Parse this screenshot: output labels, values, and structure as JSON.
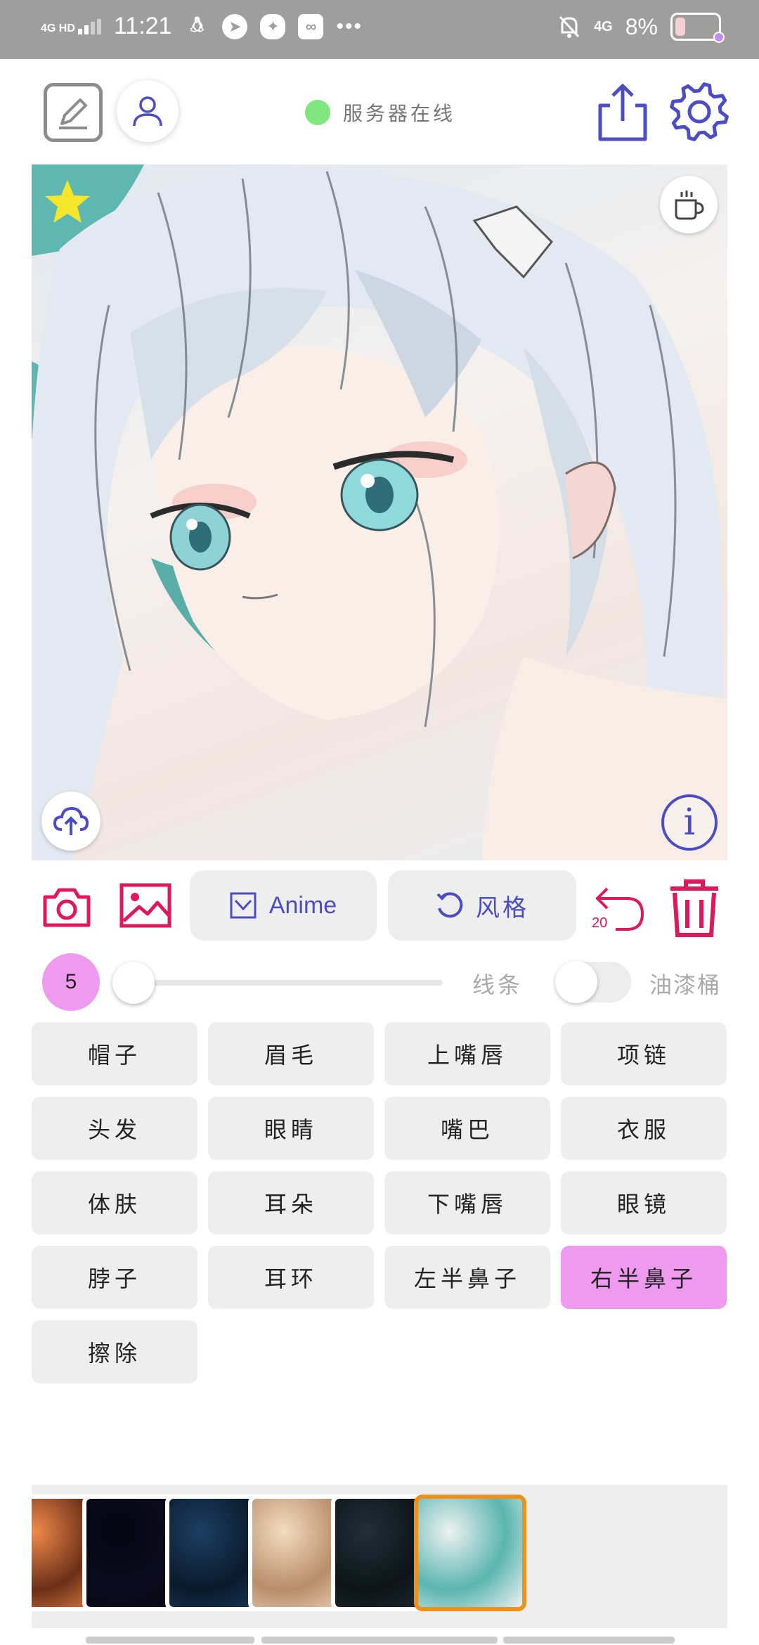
{
  "status_bar": {
    "network": "4G HD",
    "time": "11:21",
    "right_network": "4G",
    "battery_percent": "8%",
    "battery_level": 0.08,
    "icons": [
      "qq-icon",
      "compass-icon",
      "wechat-icon",
      "gallery-icon",
      "more-dots-icon",
      "mute-icon"
    ]
  },
  "top_bar": {
    "server_status": "服务器在线",
    "status_color": "#7fe57f",
    "icons": [
      "edit-icon",
      "user-icon",
      "share-icon",
      "settings-icon"
    ]
  },
  "canvas": {
    "icons": [
      "star-icon",
      "coffee-cup-icon",
      "cloud-upload-icon",
      "info-icon"
    ],
    "info_glyph": "i"
  },
  "toolbar": {
    "anime_label": "Anime",
    "style_label": "风格",
    "undo_count": "20",
    "accent_color": "#e0185a",
    "brand_color": "#4c4cc4"
  },
  "brush": {
    "size": "5",
    "slider_level": 0.0,
    "line_label": "线条",
    "bucket_label": "油漆桶",
    "bucket_toggle_on": false
  },
  "parts": [
    {
      "label": "帽子",
      "active": false
    },
    {
      "label": "眉毛",
      "active": false
    },
    {
      "label": "上嘴唇",
      "active": false
    },
    {
      "label": "项链",
      "active": false
    },
    {
      "label": "头发",
      "active": false
    },
    {
      "label": "眼睛",
      "active": false
    },
    {
      "label": "嘴巴",
      "active": false
    },
    {
      "label": "衣服",
      "active": false
    },
    {
      "label": "体肤",
      "active": false
    },
    {
      "label": "耳朵",
      "active": false
    },
    {
      "label": "下嘴唇",
      "active": false
    },
    {
      "label": "眼镜",
      "active": false
    },
    {
      "label": "脖子",
      "active": false
    },
    {
      "label": "耳环",
      "active": false
    },
    {
      "label": "左半鼻子",
      "active": false
    },
    {
      "label": "右半鼻子",
      "active": true
    },
    {
      "label": "擦除",
      "active": false
    }
  ],
  "textures": [
    {
      "name": "orange-swirl",
      "colors": [
        "#f08a4a",
        "#6a2f18"
      ],
      "selected": false
    },
    {
      "name": "black",
      "colors": [
        "#050510",
        "#0b0b1e"
      ],
      "selected": false
    },
    {
      "name": "dark-blue-silk",
      "colors": [
        "#1c3f62",
        "#0a1a2c"
      ],
      "selected": false
    },
    {
      "name": "beige-marble",
      "colors": [
        "#f3dcc0",
        "#b88d6a"
      ],
      "selected": false
    },
    {
      "name": "dark-teal",
      "colors": [
        "#203036",
        "#0c1418"
      ],
      "selected": false
    },
    {
      "name": "teal-white-swirl",
      "colors": [
        "#eef2f0",
        "#5ab5b0"
      ],
      "selected": true
    }
  ]
}
